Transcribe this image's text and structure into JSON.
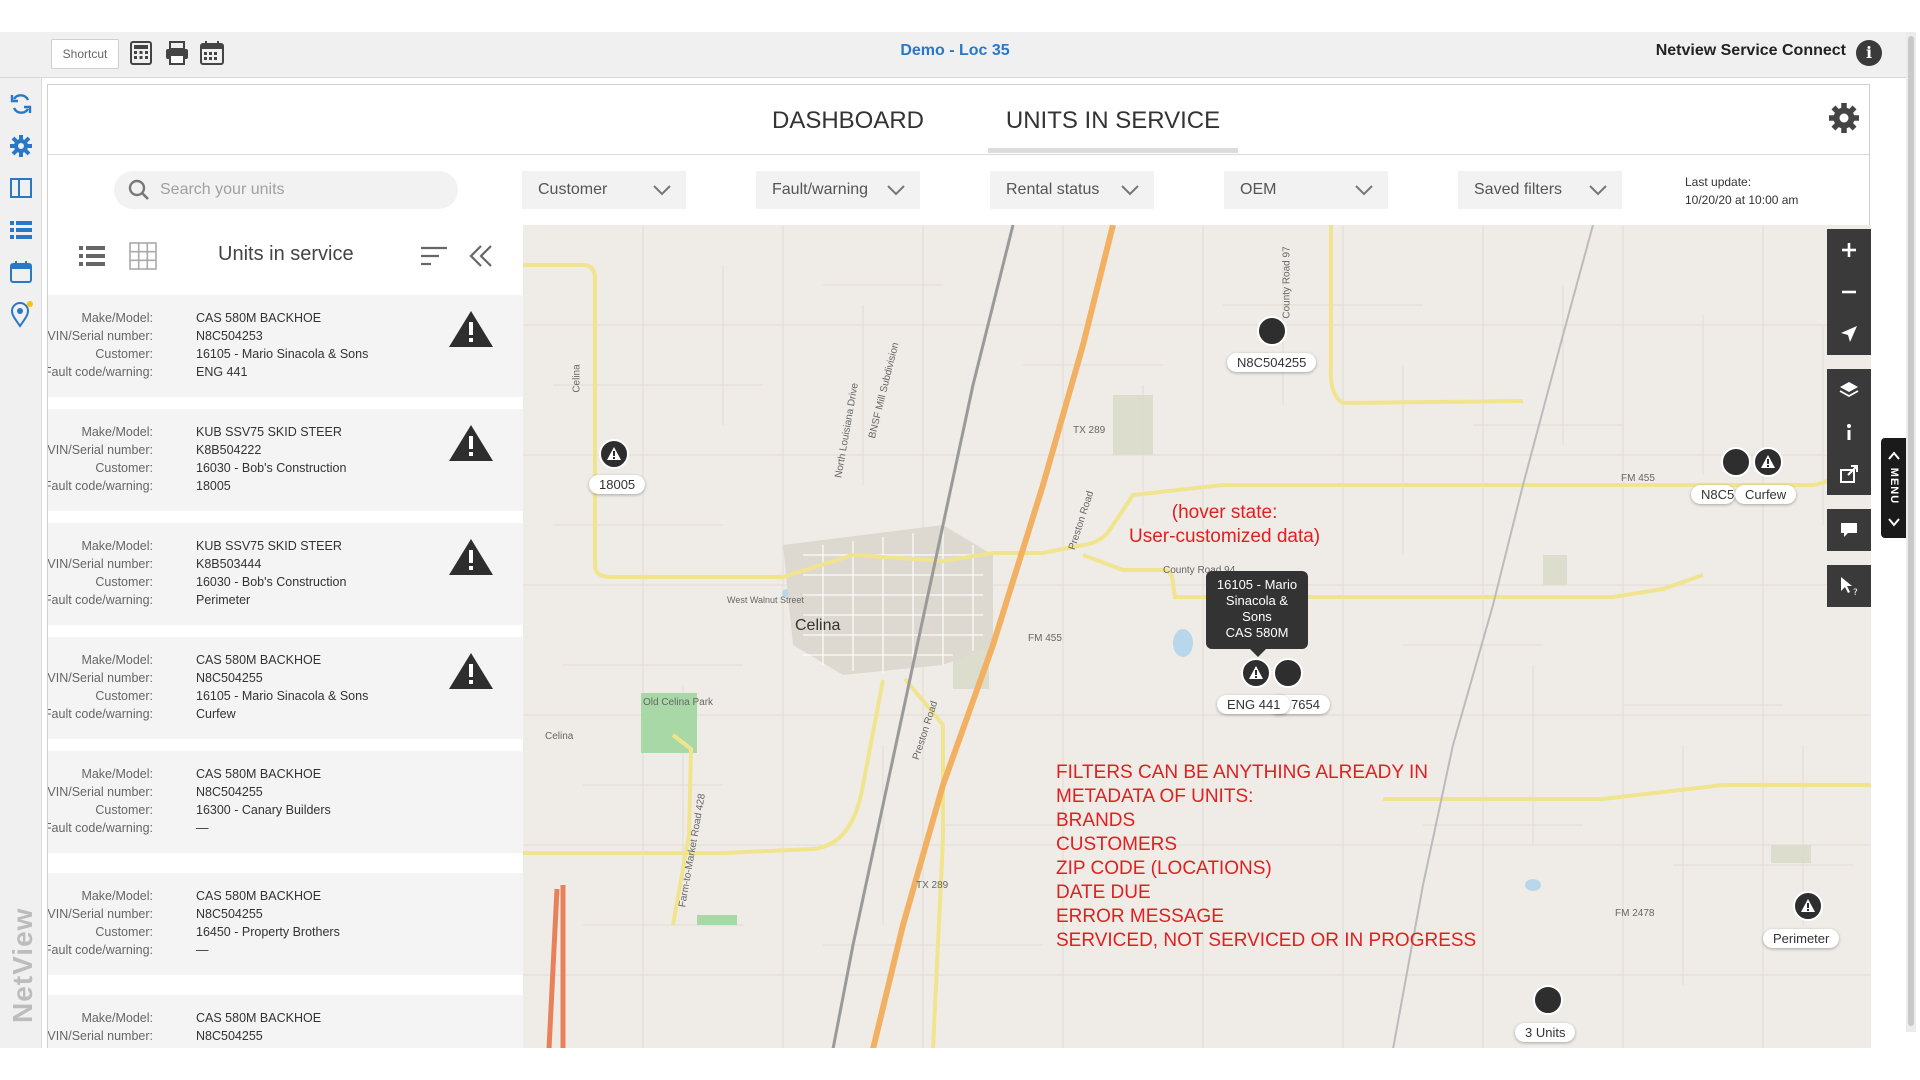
{
  "toolbar": {
    "shortcut_label": "Shortcut",
    "app_title": "Demo - Loc 35",
    "product_name": "Netview Service Connect",
    "info_label": "i",
    "icons": [
      "calculator-icon",
      "printer-icon",
      "calendar-icon",
      "info-icon"
    ]
  },
  "left_rail": {
    "icons": [
      "refresh-icon",
      "gear-icon",
      "panel-icon",
      "list-icon",
      "calendar-icon",
      "location-pin-icon"
    ],
    "brand": "NetView"
  },
  "tabs": [
    {
      "label": "DASHBOARD",
      "active": false
    },
    {
      "label": "UNITS IN SERVICE",
      "active": true
    }
  ],
  "search": {
    "placeholder": "Search your units"
  },
  "filters": [
    "Customer",
    "Fault/warning",
    "Rental status",
    "OEM",
    "Saved filters"
  ],
  "last_update": {
    "label": "Last update:",
    "value": "10/20/20 at 10:00 am"
  },
  "list": {
    "title": "Units in service",
    "field_labels": {
      "make_model": "Make/Model:",
      "vin": "VIN/Serial number:",
      "customer": "Customer:",
      "fault": "Fault code/warning:"
    },
    "units": [
      {
        "make_model": "CAS 580M BACKHOE",
        "vin": "N8C504253",
        "customer": "16105 - Mario Sinacola & Sons",
        "fault": "ENG 441",
        "warning": true
      },
      {
        "make_model": "KUB SSV75 SKID STEER",
        "vin": "K8B504222",
        "customer": "16030 - Bob's Construction",
        "fault": "18005",
        "warning": true
      },
      {
        "make_model": "KUB SSV75 SKID STEER",
        "vin": "K8B503444",
        "customer": "16030 - Bob's Construction",
        "fault": "Perimeter",
        "warning": true
      },
      {
        "make_model": "CAS 580M BACKHOE",
        "vin": "N8C504255",
        "customer": "16105 - Mario Sinacola & Sons",
        "fault": "Curfew",
        "warning": true
      },
      {
        "make_model": "CAS 580M BACKHOE",
        "vin": "N8C504255",
        "customer": "16300 - Canary Builders",
        "fault": "—",
        "warning": false
      },
      {
        "make_model": "CAS 580M BACKHOE",
        "vin": "N8C504255",
        "customer": "16450 - Property Brothers",
        "fault": "—",
        "warning": false
      },
      {
        "make_model": "CAS 580M BACKHOE",
        "vin": "N8C504255",
        "customer": "",
        "fault": "",
        "warning": false
      }
    ]
  },
  "map": {
    "labels": {
      "n8c504255": "N8C504255",
      "l18005": "18005",
      "n8c": "N8C5",
      "curfew": "Curfew",
      "eng441": "ENG 441",
      "u7654": "7654",
      "perimeter": "Perimeter",
      "units3": "3 Units"
    },
    "places": {
      "celina": "Celina",
      "celina2": "Celina",
      "celina3": "Celina",
      "old_celina_park": "Old Celina Park",
      "west_walnut": "West Walnut Street",
      "tx289": "TX 289",
      "tx289b": "TX 289",
      "fm455": "FM 455",
      "fm455b": "FM 455",
      "fm2478": "FM 2478",
      "county94": "County Road 94",
      "county97": "County Road 97",
      "preston": "Preston Road",
      "preston2": "Preston Road",
      "farm428": "Farm-to-Market Road 428",
      "louisiana": "North Louisiana Drive",
      "bnsf": "BNSF Mill Subdivision"
    },
    "tooltip_lines": [
      "16105 - Mario",
      "Sinacola &",
      "Sons",
      "CAS 580M"
    ],
    "annotation_hover": [
      "(hover state:",
      "User-customized data)"
    ],
    "annotation_filters": [
      "FILTERS CAN BE ANYTHING ALREADY IN",
      "METADATA OF UNITS:",
      "BRANDS",
      "CUSTOMERS",
      "ZIP CODE (LOCATIONS)",
      "DATE DUE",
      "ERROR MESSAGE",
      "SERVICED, NOT SERVICED OR IN PROGRESS"
    ],
    "controls": [
      "zoom-in-icon",
      "zoom-out-icon",
      "locate-icon",
      "layers-icon",
      "info-icon",
      "share-icon",
      "comment-icon",
      "cursor-help-icon"
    ],
    "menu_tab": "MENU"
  },
  "colors": {
    "accent_blue": "#2a78c5",
    "annotation_red": "#e02020",
    "marker_dark": "#2e2e2e"
  }
}
